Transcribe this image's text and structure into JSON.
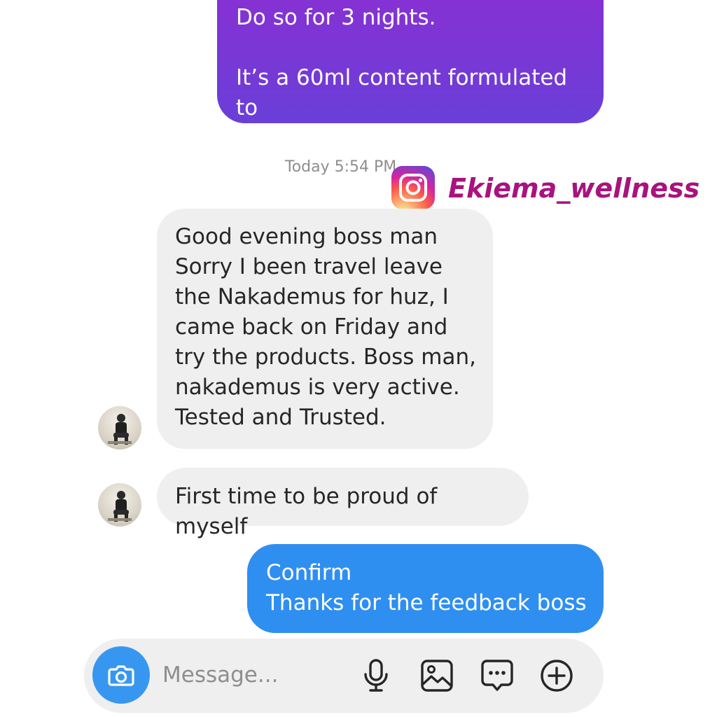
{
  "watermark": {
    "text": "Ekiema_wellness"
  },
  "thread": {
    "outgoing_purple": "Do so for 3 nights.\n\nIt’s a 60ml content formulated to\nbe taken as a single dose",
    "timestamp": "Today 5:54 PM",
    "incoming_1": "Good evening boss man\nSorry I been travel leave\nthe Nakademus for huz, I\ncame back on Friday and\ntry the products. Boss man,\nnakademus is very active.\nTested and Trusted.",
    "incoming_2": "First time to be proud of myself",
    "outgoing_blue": "Confirm\nThanks for the feedback boss"
  },
  "composer": {
    "placeholder": "Message..."
  },
  "colors": {
    "outgoing_purple": "#7a35d6",
    "outgoing_blue": "#2f8ff0",
    "incoming_bubble": "#efefef",
    "watermark": "#a8137f",
    "camera_button": "#3797f0"
  },
  "icons": [
    "instagram-logo-icon",
    "avatar",
    "camera-icon",
    "microphone-icon",
    "image-icon",
    "sticker-icon",
    "plus-circle-icon"
  ]
}
